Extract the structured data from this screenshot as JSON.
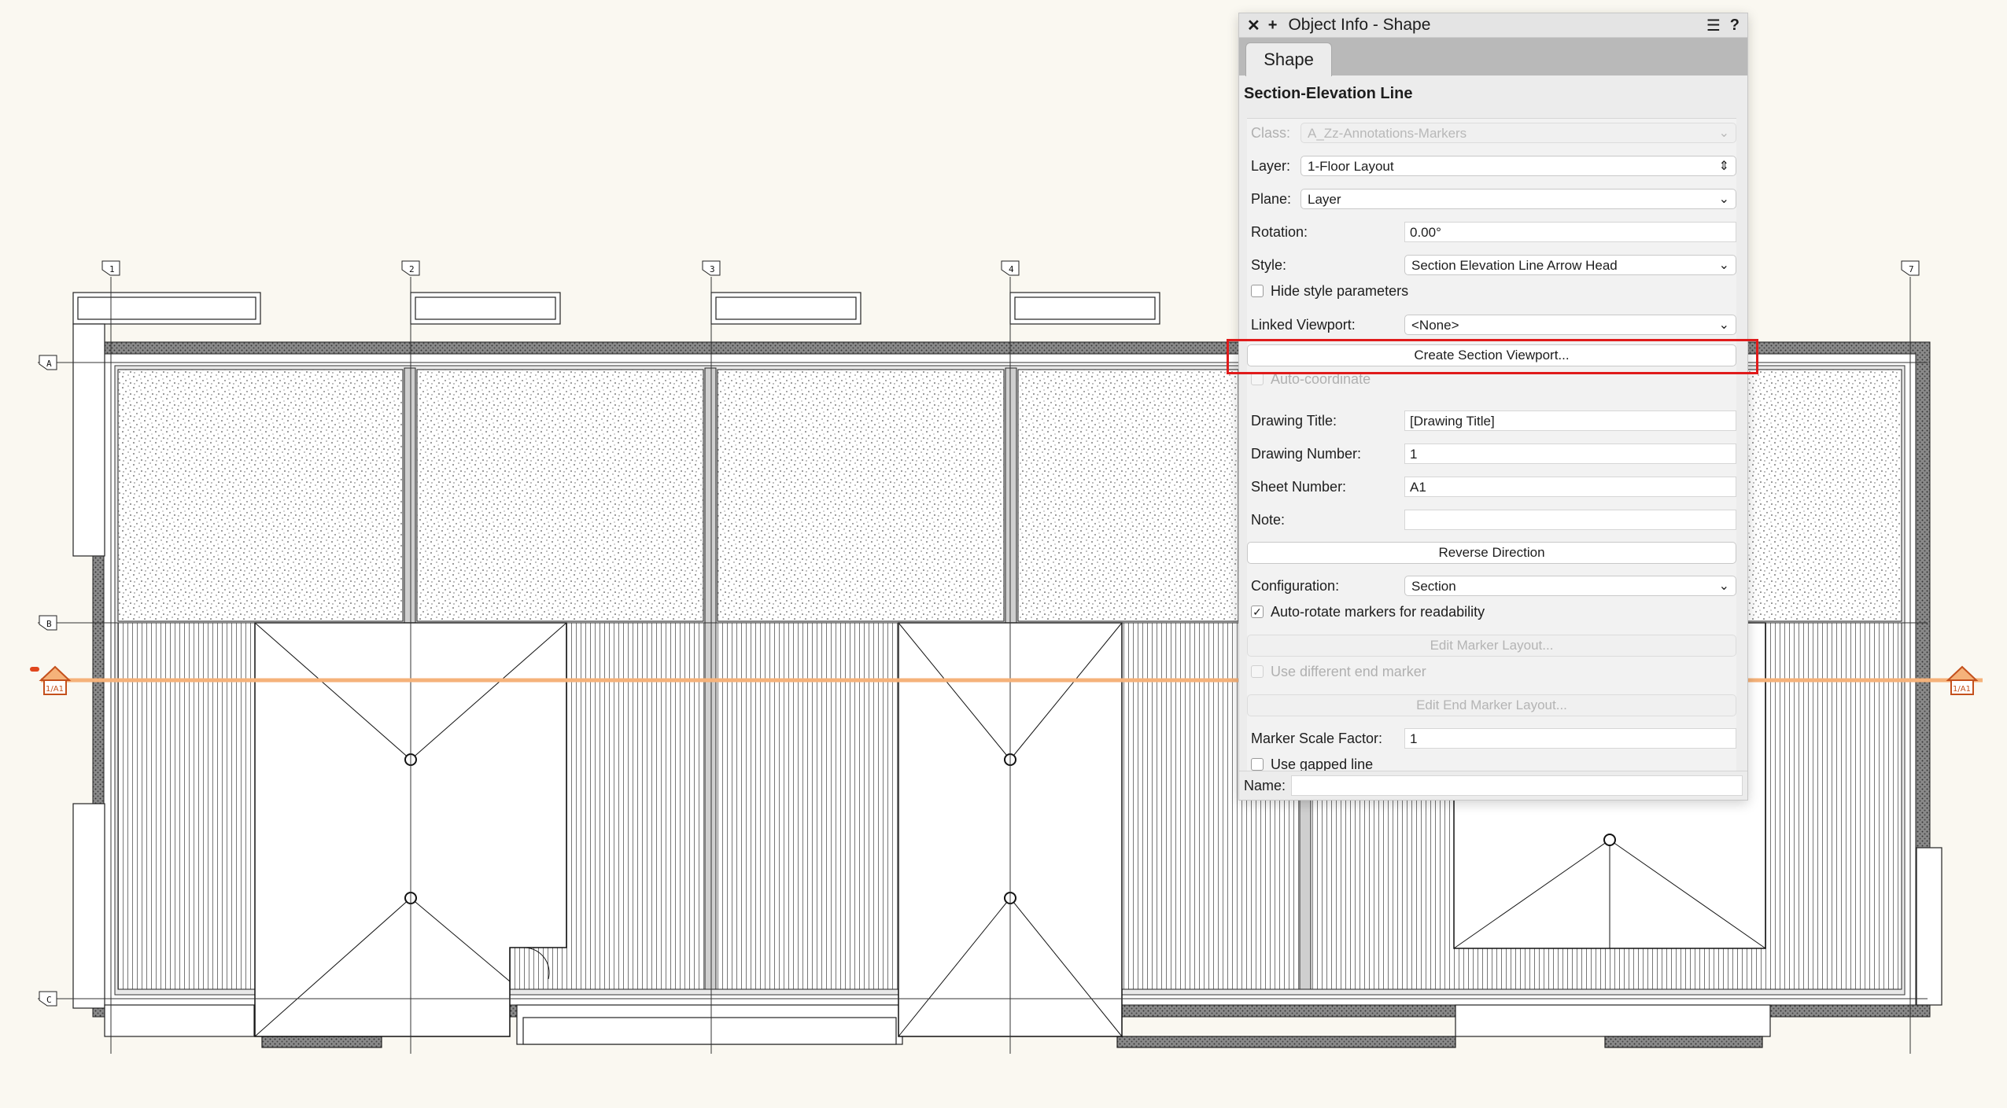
{
  "palette": {
    "title": "Object Info - Shape",
    "close_glyph": "✕",
    "add_glyph": "+",
    "menu_glyph": "☰",
    "help_glyph": "?",
    "tab_label": "Shape",
    "object_type": "Section-Elevation Line",
    "fields": {
      "class_label": "Class:",
      "class_value": "A_Zz-Annotations-Markers",
      "layer_label": "Layer:",
      "layer_value": "1-Floor Layout",
      "plane_label": "Plane:",
      "plane_value": "Layer",
      "rotation_label": "Rotation:",
      "rotation_value": "0.00°",
      "style_label": "Style:",
      "style_value": "Section Elevation Line Arrow Head",
      "hide_style_label": "Hide style parameters",
      "linked_viewport_label": "Linked Viewport:",
      "linked_viewport_value": "<None>",
      "create_section_viewport_button": "Create Section Viewport...",
      "auto_coordinate_label": "Auto-coordinate",
      "drawing_title_label": "Drawing Title:",
      "drawing_title_value": "[Drawing Title]",
      "drawing_number_label": "Drawing Number:",
      "drawing_number_value": "1",
      "sheet_number_label": "Sheet Number:",
      "sheet_number_value": "A1",
      "note_label": "Note:",
      "note_value": "",
      "reverse_direction_button": "Reverse Direction",
      "configuration_label": "Configuration:",
      "configuration_value": "Section",
      "auto_rotate_label": "Auto-rotate markers for readability",
      "auto_rotate_checked": "✓",
      "edit_marker_layout_button": "Edit Marker Layout...",
      "use_different_end_marker_label": "Use different end marker",
      "edit_end_marker_layout_button": "Edit End Marker Layout...",
      "marker_scale_factor_label": "Marker Scale Factor:",
      "marker_scale_factor_value": "1",
      "use_gapped_line_label": "Use gapped line",
      "name_label": "Name:",
      "name_value": ""
    }
  },
  "drawing": {
    "grid_columns": [
      "1",
      "2",
      "3",
      "4",
      "7"
    ],
    "grid_rows": [
      "A",
      "B",
      "C"
    ],
    "section_marker_label": "1/A1",
    "section_line_color": "#f5b27a",
    "highlight_color": "#e01b1b"
  }
}
